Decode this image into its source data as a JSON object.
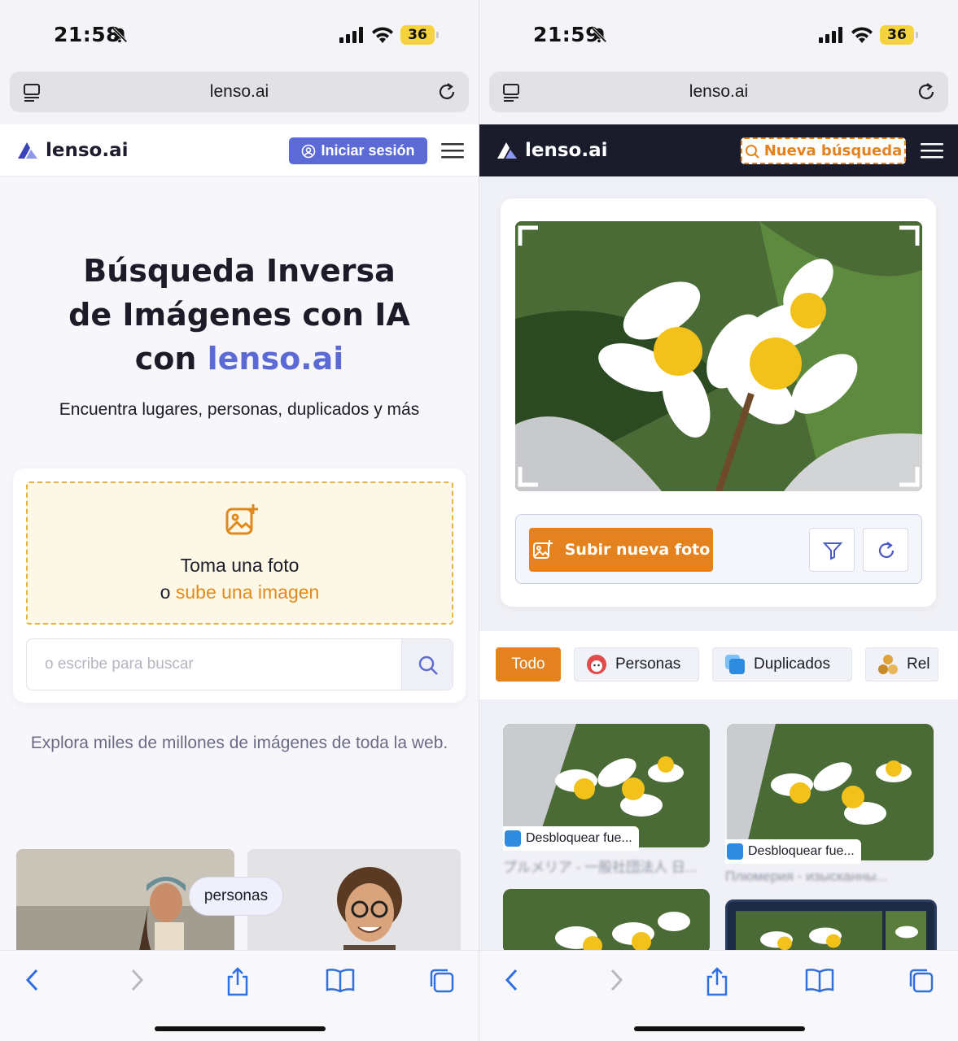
{
  "left": {
    "status": {
      "time": "21:58",
      "battery": "36"
    },
    "browser": {
      "url": "lenso.ai"
    },
    "header": {
      "logo": "lenso.ai",
      "login_label": "Iniciar sesión"
    },
    "hero": {
      "line1": "Búsqueda Inversa",
      "line2": "de Imágenes con IA",
      "line3_prefix": "con ",
      "brand": "lenso.ai"
    },
    "subtitle": "Encuentra lugares, personas, duplicados y más",
    "upload": {
      "line1": "Toma una foto",
      "line2_prefix": "o ",
      "line2_highlight": "sube una imagen"
    },
    "search": {
      "placeholder": "o escribe para buscar"
    },
    "explore_text": "Explora miles de millones de imágenes de toda la web.",
    "gallery": {
      "pill": "personas"
    }
  },
  "right": {
    "status": {
      "time": "21:59",
      "battery": "36"
    },
    "browser": {
      "url": "lenso.ai"
    },
    "header": {
      "logo": "lenso.ai",
      "new_search_label": "Nueva búsqueda"
    },
    "upload_button": "Subir nueva foto",
    "tabs": [
      {
        "label": "Todo",
        "active": true
      },
      {
        "label": "Personas",
        "icon": "face-icon"
      },
      {
        "label": "Duplicados",
        "icon": "duplicate-icon"
      },
      {
        "label": "Rel",
        "icon": "related-icon"
      }
    ],
    "results": [
      {
        "label": "Desbloquear fue...",
        "source": "プルメリア - 一般社団法人 日..."
      },
      {
        "label": "Desbloquear fue...",
        "source": "Плюмерия - изысканны..."
      }
    ]
  },
  "colors": {
    "brand": "#5c6ad6",
    "accent": "#e3821e",
    "dark_header": "#1a1c2b"
  }
}
